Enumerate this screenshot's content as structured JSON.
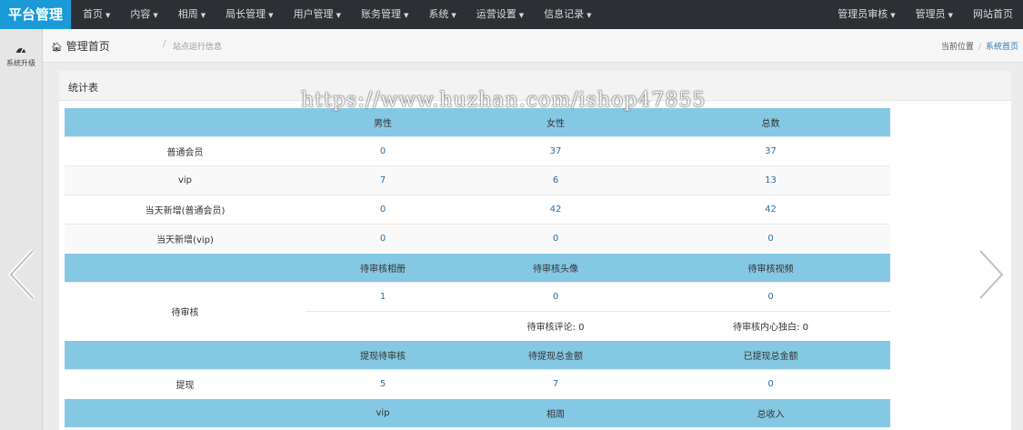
{
  "header": {
    "brand": "平台管理",
    "nav_left": [
      "首页",
      "内容",
      "相周",
      "局长管理",
      "用户管理",
      "账务管理",
      "系统",
      "运营设置",
      "信息记录"
    ],
    "nav_right": [
      "管理员审核",
      "管理员",
      "网站首页"
    ]
  },
  "sidebar": {
    "items": [
      {
        "label": "系统升级",
        "icon": "dashboard-icon"
      }
    ]
  },
  "breadcrumb": {
    "home": "管理首页",
    "current": "站点运行信息",
    "location_label": "当前位置",
    "location_link": "系统首页"
  },
  "panel": {
    "title": "统计表"
  },
  "watermark": "https://www.huzhan.com/ishop47855",
  "stats": {
    "section1": {
      "headers": [
        "",
        "男性",
        "女性",
        "总数"
      ],
      "rows": [
        [
          "普通会员",
          "0",
          "37",
          "37"
        ],
        [
          "vip",
          "7",
          "6",
          "13"
        ],
        [
          "当天新增(普通会员)",
          "0",
          "42",
          "42"
        ],
        [
          "当天新增(vip)",
          "0",
          "0",
          "0"
        ]
      ]
    },
    "section2": {
      "headers": [
        "",
        "待审核相册",
        "待审核头像",
        "待审核视频"
      ],
      "label": "待审核",
      "values": [
        "1",
        "0",
        "0"
      ],
      "sub_comment": "待审核评论: 0",
      "sub_heart": "待审核内心独白: 0"
    },
    "section3": {
      "headers": [
        "",
        "提现待审核",
        "待提现总金额",
        "已提现总金额"
      ],
      "label": "提现",
      "values": [
        "5",
        "7",
        "0"
      ]
    },
    "section4": {
      "headers": [
        "",
        "vip",
        "相周",
        "总收入"
      ]
    }
  }
}
